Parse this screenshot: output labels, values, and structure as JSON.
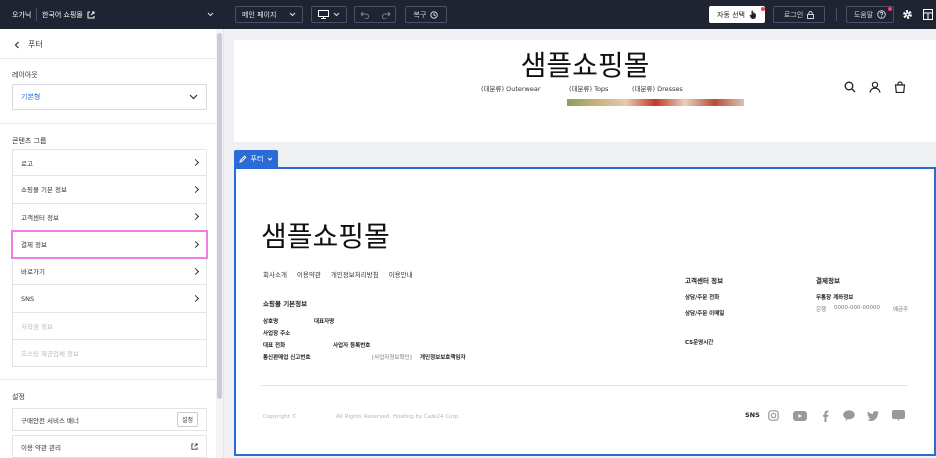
{
  "topbar": {
    "brand": "오가닉",
    "shop": "한국어 쇼핑몰",
    "page_select": "메인 페이지",
    "restore": "복구",
    "auto_select": "자동 선택",
    "login": "로그인",
    "help": "도움말"
  },
  "left": {
    "back_label": "푸터",
    "layout_title": "레이아웃",
    "layout_value": "기본형",
    "content_group_title": "콘텐츠 그룹",
    "items": [
      {
        "label": "로고",
        "enabled": true
      },
      {
        "label": "쇼핑몰 기본 정보",
        "enabled": true
      },
      {
        "label": "고객센터 정보",
        "enabled": true
      },
      {
        "label": "결제 정보",
        "enabled": true
      },
      {
        "label": "바로가기",
        "enabled": true
      },
      {
        "label": "SNS",
        "enabled": true
      },
      {
        "label": "저작권 정보",
        "enabled": false
      },
      {
        "label": "호스팅 제공업체 정보",
        "enabled": false
      }
    ],
    "settings_title": "설정",
    "settings_items": [
      {
        "label": "구매안전 서비스 배너",
        "button": "설정"
      },
      {
        "label": "이용 약관 관리"
      }
    ]
  },
  "preview": {
    "logo": "샘플쇼핑몰",
    "nav": [
      "(대분류) Outerwear",
      "(대분류) Tops",
      "(대분류) Dresses"
    ],
    "footer_tag": "푸터",
    "footer": {
      "logo": "샘플쇼핑몰",
      "links": [
        "회사소개",
        "이용약관",
        "개인정보처리방침",
        "이용안내"
      ],
      "basic_info_title": "쇼핑몰 기본정보",
      "basic_info": {
        "company": "상호명",
        "ceo": "대표자명",
        "address": "사업장 주소",
        "phone": "대표 전화",
        "biz_no": "사업자 등록번호",
        "mail_order": "통신판매업 신고번호",
        "biz_check": "[사업자정보확인]",
        "privacy_officer": "개인정보보호책임자"
      },
      "cs_title": "고객센터 정보",
      "cs_items": [
        "상담/주문 전화",
        "상담/주문 이메일",
        "CS운영시간"
      ],
      "pay_title": "결제정보",
      "pay_account_label": "무통장 계좌정보",
      "pay_bank": "은행",
      "pay_number": "0000-000-00000",
      "pay_holder": "예금주",
      "copyright_left": "Copyright ©",
      "copyright_right": "All Rights Reserved. Hosting by Cafe24 Corp.",
      "sns_label": "SNS",
      "sns_icons": [
        "instagram-icon",
        "youtube-icon",
        "facebook-icon",
        "talk-icon",
        "twitter-icon",
        "blog-icon"
      ]
    }
  },
  "colors": {
    "topbar": "#1f2433",
    "accent": "#2a6bd8",
    "highlight": "#ef7fe6"
  }
}
